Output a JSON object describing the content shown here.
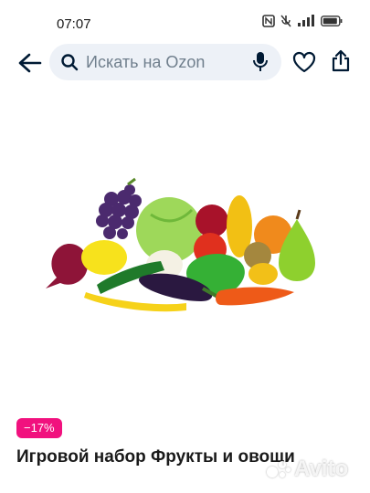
{
  "status_bar": {
    "time": "07:07"
  },
  "search": {
    "placeholder": "Искать на Ozon"
  },
  "product": {
    "discount_badge": "−17%",
    "title": "Игровой набор Фрукты и овощи"
  },
  "watermark": {
    "text": "Avito"
  },
  "icons": {
    "back": "arrow-left-icon",
    "search": "search-icon",
    "mic": "microphone-icon",
    "favorite": "heart-icon",
    "share": "share-icon"
  }
}
